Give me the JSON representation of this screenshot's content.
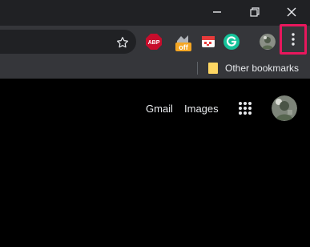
{
  "window_controls": {
    "minimize_icon": "minimize-icon",
    "restore_icon": "restore-icon",
    "close_icon": "close-icon"
  },
  "extensions": [
    {
      "name": "abp",
      "label": "ABP",
      "color": "#c70d2c"
    },
    {
      "name": "off-coupon",
      "label": "off",
      "color": "#f5a623"
    },
    {
      "name": "clipper",
      "label": "",
      "color": "#e63b3b"
    },
    {
      "name": "grammarly",
      "label": "",
      "color": "#15c39a"
    }
  ],
  "bookmarks_bar": {
    "other_bookmarks_label": "Other bookmarks"
  },
  "google_header": {
    "gmail_label": "Gmail",
    "images_label": "Images"
  },
  "colors": {
    "highlight": "#e8175d",
    "toolbar_bg": "#35363a",
    "titlebar_bg": "#202124",
    "page_bg": "#000000"
  }
}
